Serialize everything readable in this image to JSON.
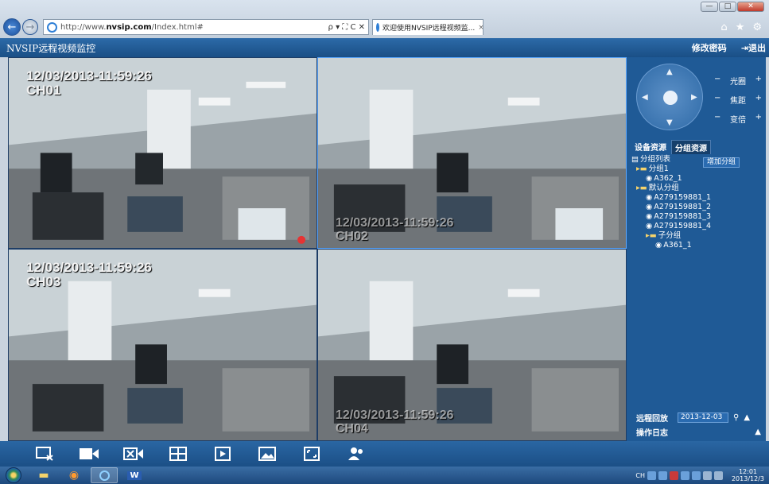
{
  "browser": {
    "url_prefix": "http://www.",
    "url_domain": "nvsip.com",
    "url_suffix": "/Index.html#",
    "addr_controls": "ρ ▾ ⛶ C ✕",
    "tab_title": "欢迎使用NVSIP远程视频监...",
    "tab_close": "×",
    "toolbar_icons": [
      "home-icon",
      "star-icon",
      "settings-icon"
    ],
    "window_buttons": [
      "minimize",
      "maximize",
      "close"
    ]
  },
  "app": {
    "title": "NVSIP远程视频监控",
    "change_password": "修改密码",
    "logout": "退出"
  },
  "video": {
    "channels": [
      {
        "osd_top": "12/03/2013-11:59:26",
        "osd_ch": "CH01",
        "osd_position": "top"
      },
      {
        "osd_top": "12/03/2013-11:59:26",
        "osd_ch": "CH02",
        "osd_position": "bottom"
      },
      {
        "osd_top": "12/03/2013-11:59:26",
        "osd_ch": "CH03",
        "osd_position": "top"
      },
      {
        "osd_top": "12/03/2013-11:59:26",
        "osd_ch": "CH04",
        "osd_position": "bottom"
      }
    ]
  },
  "ptz": {
    "aperture": "光圈",
    "focus": "焦距",
    "zoom": "变倍",
    "minus": "−",
    "plus": "+"
  },
  "resources": {
    "tab_devices": "设备资源",
    "tab_groups": "分组资源",
    "active_tab": "groups",
    "add_group": "增加分组",
    "tree": [
      {
        "label": "分组列表",
        "level": 0,
        "icon": "list-icon"
      },
      {
        "label": "分组1",
        "level": 1,
        "icon": "folder-icon"
      },
      {
        "label": "A362_1",
        "level": 2,
        "icon": "camera-icon"
      },
      {
        "label": "默认分组",
        "level": 1,
        "icon": "folder-icon"
      },
      {
        "label": "A279159881_1",
        "level": 2,
        "icon": "camera-icon"
      },
      {
        "label": "A279159881_2",
        "level": 2,
        "icon": "camera-icon"
      },
      {
        "label": "A279159881_3",
        "level": 2,
        "icon": "camera-icon"
      },
      {
        "label": "A279159881_4",
        "level": 2,
        "icon": "camera-icon"
      },
      {
        "label": "子分组",
        "level": 2,
        "icon": "folder-icon"
      },
      {
        "label": "A361_1",
        "level": 3,
        "icon": "camera-icon"
      }
    ]
  },
  "playback": {
    "label": "远程回放",
    "date": "2013-12-03",
    "log_label": "操作日志"
  },
  "toolbar": {
    "buttons": [
      "close-all-icon",
      "record-icon",
      "stop-record-icon",
      "layout-quad-icon",
      "play-icon",
      "snapshot-icon",
      "fullscreen-icon",
      "users-icon"
    ]
  },
  "taskbar": {
    "input_lang": "CH",
    "clock_time": "12:01",
    "clock_date": "2013/12/3"
  },
  "colors": {
    "header": "#1f5a96",
    "accent": "#5aa7ff"
  }
}
